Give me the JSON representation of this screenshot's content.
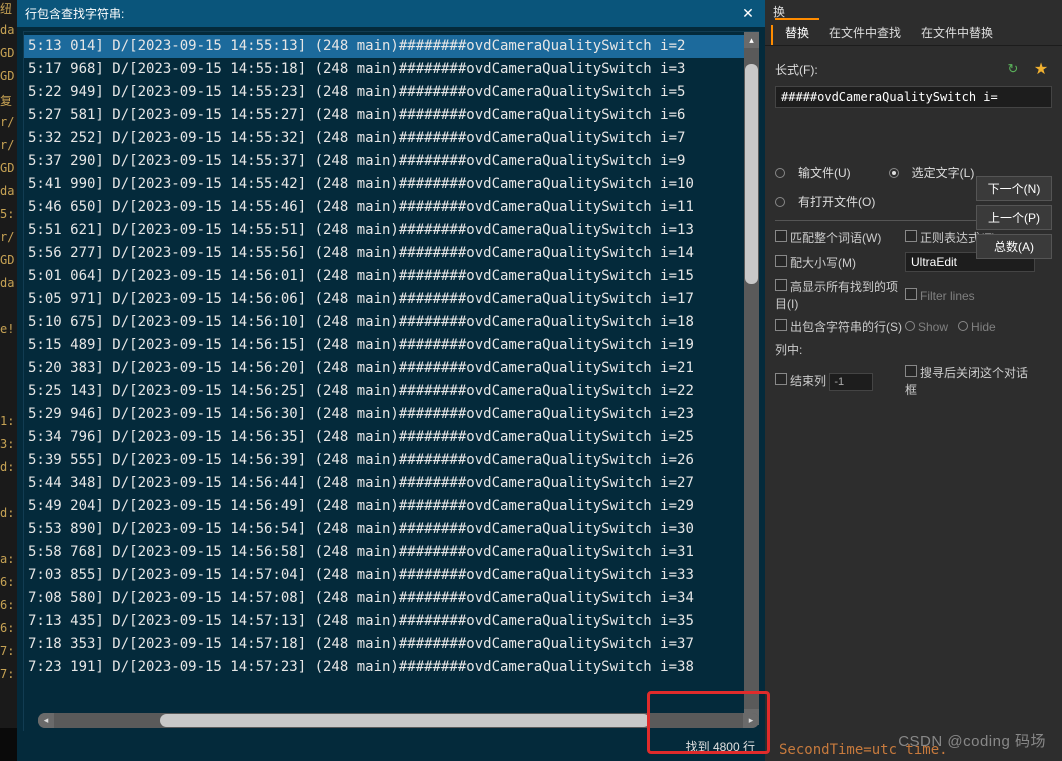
{
  "gutter": [
    "纽",
    "da",
    "GD",
    "GD",
    "复",
    "r/",
    "r/",
    "GD",
    "da",
    "5:",
    "r/",
    "GD",
    "da",
    "",
    "e!",
    "",
    "",
    "",
    "1:",
    "3:",
    "d:",
    "",
    "d:",
    "",
    "a:",
    "6:",
    "6:",
    "6:",
    "7:",
    "7:",
    "",
    ""
  ],
  "panel": {
    "title": "行包含查找字符串:",
    "status": "找到 4800 行"
  },
  "results": [
    {
      "t": "5:13 014] D/[2023-09-15 14:55:13] (248 main)########ovdCameraQualitySwitch i=2",
      "sel": true
    },
    {
      "t": "5:17 968] D/[2023-09-15 14:55:18] (248 main)########ovdCameraQualitySwitch i=3"
    },
    {
      "t": "5:22 949] D/[2023-09-15 14:55:23] (248 main)########ovdCameraQualitySwitch i=5"
    },
    {
      "t": "5:27 581] D/[2023-09-15 14:55:27] (248 main)########ovdCameraQualitySwitch i=6"
    },
    {
      "t": "5:32 252] D/[2023-09-15 14:55:32] (248 main)########ovdCameraQualitySwitch i=7"
    },
    {
      "t": "5:37 290] D/[2023-09-15 14:55:37] (248 main)########ovdCameraQualitySwitch i=9"
    },
    {
      "t": "5:41 990] D/[2023-09-15 14:55:42] (248 main)########ovdCameraQualitySwitch i=10"
    },
    {
      "t": "5:46 650] D/[2023-09-15 14:55:46] (248 main)########ovdCameraQualitySwitch i=11"
    },
    {
      "t": "5:51 621] D/[2023-09-15 14:55:51] (248 main)########ovdCameraQualitySwitch i=13"
    },
    {
      "t": "5:56 277] D/[2023-09-15 14:55:56] (248 main)########ovdCameraQualitySwitch i=14"
    },
    {
      "t": "5:01 064] D/[2023-09-15 14:56:01] (248 main)########ovdCameraQualitySwitch i=15"
    },
    {
      "t": "5:05 971] D/[2023-09-15 14:56:06] (248 main)########ovdCameraQualitySwitch i=17"
    },
    {
      "t": "5:10 675] D/[2023-09-15 14:56:10] (248 main)########ovdCameraQualitySwitch i=18"
    },
    {
      "t": "5:15 489] D/[2023-09-15 14:56:15] (248 main)########ovdCameraQualitySwitch i=19"
    },
    {
      "t": "5:20 383] D/[2023-09-15 14:56:20] (248 main)########ovdCameraQualitySwitch i=21"
    },
    {
      "t": "5:25 143] D/[2023-09-15 14:56:25] (248 main)########ovdCameraQualitySwitch i=22"
    },
    {
      "t": "5:29 946] D/[2023-09-15 14:56:30] (248 main)########ovdCameraQualitySwitch i=23"
    },
    {
      "t": "5:34 796] D/[2023-09-15 14:56:35] (248 main)########ovdCameraQualitySwitch i=25"
    },
    {
      "t": "5:39 555] D/[2023-09-15 14:56:39] (248 main)########ovdCameraQualitySwitch i=26"
    },
    {
      "t": "5:44 348] D/[2023-09-15 14:56:44] (248 main)########ovdCameraQualitySwitch i=27"
    },
    {
      "t": "5:49 204] D/[2023-09-15 14:56:49] (248 main)########ovdCameraQualitySwitch i=29"
    },
    {
      "t": "5:53 890] D/[2023-09-15 14:56:54] (248 main)########ovdCameraQualitySwitch i=30"
    },
    {
      "t": "5:58 768] D/[2023-09-15 14:56:58] (248 main)########ovdCameraQualitySwitch i=31"
    },
    {
      "t": "7:03 855] D/[2023-09-15 14:57:04] (248 main)########ovdCameraQualitySwitch i=33"
    },
    {
      "t": "7:08 580] D/[2023-09-15 14:57:08] (248 main)########ovdCameraQualitySwitch i=34"
    },
    {
      "t": "7:13 435] D/[2023-09-15 14:57:13] (248 main)########ovdCameraQualitySwitch i=35"
    },
    {
      "t": "7:18 353] D/[2023-09-15 14:57:18] (248 main)########ovdCameraQualitySwitch i=37"
    },
    {
      "t": "7:23 191] D/[2023-09-15 14:57:23] (248 main)########ovdCameraQualitySwitch i=38"
    }
  ],
  "right": {
    "title": "换",
    "tabs": [
      "替换",
      "在文件中查找",
      "在文件中替换"
    ],
    "find_label": "长式(F):",
    "find_value": "#####ovdCameraQualitySwitch i=",
    "in_file": "输文件(U)",
    "select_text": "选定文字(L)",
    "all_open": "有打开文件(O)",
    "next_btn": "下一个(N)",
    "prev_btn": "上一个(P)",
    "count_btn": "总数(A)",
    "whole_word": "匹配整个词语(W)",
    "regex": "正则表达式(E)",
    "match_case": "配大小写(M)",
    "regex_engine": "UltraEdit",
    "highlight": "高显示所有找到的项目(I)",
    "filter": "Filter lines",
    "out_lines": "出包含字符串的行(S)",
    "show": "Show",
    "hide": "Hide",
    "column_in": "列中:",
    "end_col": "结束列",
    "end_col_val": "-1",
    "close_after": "搜寻后关闭这个对话框"
  },
  "bottom_text": "SecondTime=utc time.",
  "watermark": "CSDN @coding 码场"
}
